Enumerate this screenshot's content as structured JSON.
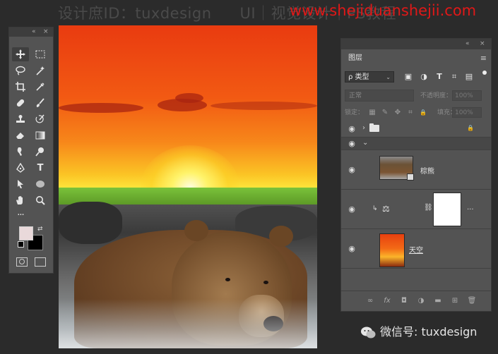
{
  "watermark_top": {
    "left_text": "设计庶ID：tuxdesign",
    "middle_text": "UI｜视觉设计｜PS教程",
    "url_text": "www.shejiduanshejii.com"
  },
  "toolbar": {
    "collapse_label": "«",
    "close_label": "×",
    "tools": [
      "move-tool",
      "marquee-tool",
      "lasso-tool",
      "magic-wand-tool",
      "crop-tool",
      "eyedropper-tool",
      "healing-tool",
      "brush-tool",
      "stamp-tool",
      "history-brush-tool",
      "eraser-tool",
      "gradient-tool",
      "smudge-tool",
      "dodge-tool",
      "pen-tool",
      "type-tool",
      "path-select-tool",
      "shape-tool",
      "hand-tool",
      "zoom-tool",
      "more-tool"
    ],
    "type_glyph": "T",
    "more_glyph": "···",
    "colors": {
      "foreground": "#e9d9da",
      "background": "#000000"
    }
  },
  "layers_panel": {
    "collapse_label": "«",
    "close_label": "×",
    "tab_label": "图层",
    "menu_glyph": "≡",
    "filter": {
      "label": "类型",
      "prefix": "ρ",
      "caret": "⌄"
    },
    "filter_icons": [
      "▣",
      "◑",
      "T",
      "⌗",
      "▤"
    ],
    "blend_mode": "正常",
    "opacity_label": "不透明度：",
    "opacity_value": "100%",
    "lock_label": "锁定：",
    "lock_icons": [
      "▦",
      "✎",
      "✥",
      "⌗",
      "🔒"
    ],
    "fill_label": "填充：",
    "fill_value": "100%",
    "layers": [
      {
        "name": "",
        "type": "group",
        "locked": true
      },
      {
        "name": "",
        "type": "group-expanded"
      },
      {
        "name": "棕熊",
        "type": "smart-object"
      },
      {
        "name": "",
        "type": "adjustment-balance",
        "dots": "..."
      },
      {
        "name": "天空",
        "type": "image"
      }
    ],
    "eye_glyph": "◉",
    "chev_closed": "›",
    "chev_open": "⌄",
    "lock_glyph": "🔒",
    "clip_arrow": "↳",
    "balance_glyph": "⚖",
    "chain_glyph": "⛓",
    "footer_icons": [
      "∞",
      "fx",
      "◘",
      "◑",
      "▬",
      "⊞",
      "🗑"
    ]
  },
  "wechat_watermark": {
    "text": "微信号: tuxdesign"
  }
}
